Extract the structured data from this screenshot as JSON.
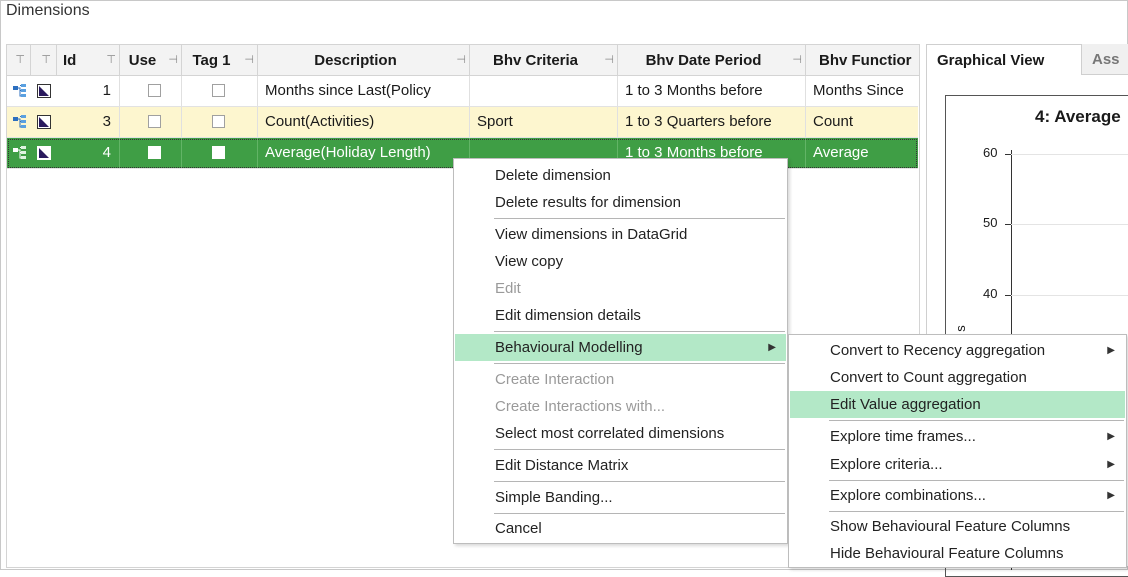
{
  "window": {
    "title": "Dimensions"
  },
  "grid": {
    "columns": [
      {
        "label": "",
        "pin": "⊤"
      },
      {
        "label": "",
        "pin": "⊤"
      },
      {
        "label": "Id",
        "pin": "⊤"
      },
      {
        "label": "Use",
        "pin": "⊣"
      },
      {
        "label": "Tag 1",
        "pin": "⊣"
      },
      {
        "label": "Description",
        "pin": "⊣"
      },
      {
        "label": "Bhv Criteria",
        "pin": "⊣"
      },
      {
        "label": "Bhv Date Period",
        "pin": "⊣"
      },
      {
        "label": "Bhv Functior",
        "pin": ""
      }
    ],
    "rows": [
      {
        "id": "1",
        "use": false,
        "tag1": false,
        "description": "Months since Last(Policy",
        "criteria": "",
        "date_period": "1 to 3 Months before",
        "function": "Months Since",
        "style": "normal"
      },
      {
        "id": "3",
        "use": false,
        "tag1": false,
        "description": "Count(Activities)",
        "criteria": "Sport",
        "date_period": "1 to 3 Quarters before",
        "function": "Count",
        "style": "alt"
      },
      {
        "id": "4",
        "use": false,
        "tag1": false,
        "description": "Average(Holiday Length)",
        "criteria": "",
        "date_period": "1 to 3 Months before",
        "function": "Average",
        "style": "selected"
      }
    ]
  },
  "right_panel": {
    "tabs": [
      {
        "label": "Graphical View"
      },
      {
        "label": "Ass"
      }
    ],
    "chart_title": "4: Average",
    "y_ticks": [
      "60",
      "50",
      "40"
    ],
    "y_label_fragment": "s"
  },
  "context_menu": {
    "items": [
      {
        "label": "Delete dimension",
        "enabled": true
      },
      {
        "label": "Delete results for dimension",
        "enabled": true
      },
      {
        "label": "View dimensions in DataGrid",
        "enabled": true
      },
      {
        "label": "View copy",
        "enabled": true
      },
      {
        "label": "Edit",
        "enabled": false
      },
      {
        "label": "Edit dimension details",
        "enabled": true
      },
      {
        "label": "Behavioural Modelling",
        "enabled": true,
        "highlighted": true,
        "submenu": true
      },
      {
        "label": "Create Interaction",
        "enabled": false
      },
      {
        "label": "Create Interactions with...",
        "enabled": false
      },
      {
        "label": "Select most correlated dimensions",
        "enabled": true
      },
      {
        "label": "Edit Distance Matrix",
        "enabled": true
      },
      {
        "label": "Simple Banding...",
        "enabled": true
      },
      {
        "label": "Cancel",
        "enabled": true
      }
    ]
  },
  "submenu": {
    "items": [
      {
        "label": "Convert to Recency aggregation",
        "submenu": true
      },
      {
        "label": "Convert to Count aggregation"
      },
      {
        "label": "Edit Value aggregation",
        "highlighted": true
      },
      {
        "label": "Explore time frames...",
        "submenu": true
      },
      {
        "label": "Explore criteria...",
        "submenu": true
      },
      {
        "label": "Explore combinations...",
        "submenu": true
      },
      {
        "label": "Show Behavioural Feature Columns"
      },
      {
        "label": "Hide Behavioural Feature Columns"
      }
    ]
  },
  "colors": {
    "selected_row": "#3f9e45",
    "alt_row": "#fdf6cf",
    "menu_highlight": "#b3e8c7"
  },
  "icons": {
    "row_type": "hierarchy-icon",
    "row_kind": "dimension-triangle-icon",
    "submenu_arrow": "▶"
  }
}
